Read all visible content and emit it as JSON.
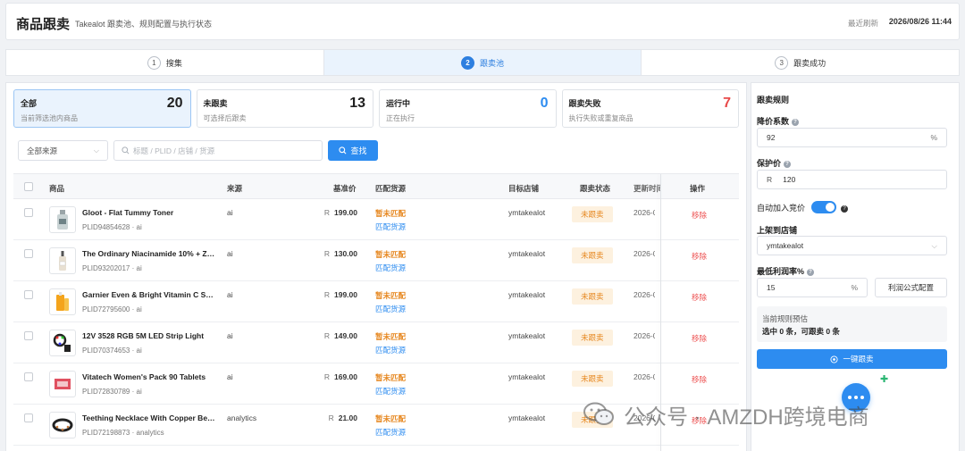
{
  "header": {
    "title": "商品跟卖",
    "subtitle": "Takealot 跟卖池、规则配置与执行状态",
    "refresh_label": "最近刷新",
    "refresh_time": "2026/08/26 11:44"
  },
  "steps": [
    {
      "num": "1",
      "label": "搜集"
    },
    {
      "num": "2",
      "label": "跟卖池"
    },
    {
      "num": "3",
      "label": "跟卖成功"
    }
  ],
  "stats": [
    {
      "label": "全部",
      "desc": "当前筛选池内商品",
      "value": "20",
      "color": "#1f1f1f"
    },
    {
      "label": "未跟卖",
      "desc": "可选择后跟卖",
      "value": "13",
      "color": "#1f1f1f"
    },
    {
      "label": "运行中",
      "desc": "正在执行",
      "value": "0",
      "color": "#2d8cf0"
    },
    {
      "label": "跟卖失败",
      "desc": "执行失败或重复商品",
      "value": "7",
      "color": "#e84a4a"
    }
  ],
  "filters": {
    "source_select": "全部来源",
    "search_placeholder": "标题 / PLID / 店铺 / 货源",
    "query_button": "查找"
  },
  "table": {
    "columns": {
      "product": "商品",
      "source": "来源",
      "base_price": "基准价",
      "match_source": "匹配货源",
      "target_store": "目标店铺",
      "follow_status": "跟卖状态",
      "updated": "更新时间",
      "action": "操作"
    },
    "rows": [
      {
        "name": "Gloot - Flat Tummy Toner",
        "plid": "PLID94854628 · ai",
        "source": "ai",
        "currency": "R",
        "price": "199.00",
        "match_status": "暂未匹配",
        "match_link": "匹配货源",
        "store": "ymtakealot",
        "status": "未跟卖",
        "updated": "2026-0",
        "action": "移除",
        "thumb": "bottle"
      },
      {
        "name": "The Ordinary Niacinamide 10% + Zinc 1%",
        "plid": "PLID93202017 · ai",
        "source": "ai",
        "currency": "R",
        "price": "130.00",
        "match_status": "暂未匹配",
        "match_link": "匹配货源",
        "store": "ymtakealot",
        "status": "未跟卖",
        "updated": "2026-0",
        "action": "移除",
        "thumb": "dropper"
      },
      {
        "name": "Garnier Even & Bright Vitamin C Serum",
        "plid": "PLID72795600 · ai",
        "source": "ai",
        "currency": "R",
        "price": "199.00",
        "match_status": "暂未匹配",
        "match_link": "匹配货源",
        "store": "ymtakealot",
        "status": "未跟卖",
        "updated": "2026-0",
        "action": "移除",
        "thumb": "serum"
      },
      {
        "name": "12V 3528 RGB 5M LED Strip Light",
        "plid": "PLID70374653 · ai",
        "source": "ai",
        "currency": "R",
        "price": "149.00",
        "match_status": "暂未匹配",
        "match_link": "匹配货源",
        "store": "ymtakealot",
        "status": "未跟卖",
        "updated": "2026-0",
        "action": "移除",
        "thumb": "led"
      },
      {
        "name": "Vitatech Women's Pack 90 Tablets",
        "plid": "PLID72830789 · ai",
        "source": "ai",
        "currency": "R",
        "price": "169.00",
        "match_status": "暂未匹配",
        "match_link": "匹配货源",
        "store": "ymtakealot",
        "status": "未跟卖",
        "updated": "2026-0",
        "action": "移除",
        "thumb": "pack"
      },
      {
        "name": "Teething Necklace With Copper Beads",
        "plid": "PLID72198873 · analytics",
        "source": "analytics",
        "currency": "R",
        "price": "21.00",
        "match_status": "暂未匹配",
        "match_link": "匹配货源",
        "store": "ymtakealot",
        "status": "未跟卖",
        "updated": "2026-0",
        "action": "移除",
        "thumb": "necklace"
      }
    ]
  },
  "rules": {
    "title": "跟卖规则",
    "discount_label": "降价系数",
    "discount_value": "92",
    "discount_suffix": "%",
    "protect_label": "保护价",
    "protect_prefix": "R",
    "protect_value": "120",
    "auto_bid_label": "自动加入竞价",
    "store_label": "上架到店铺",
    "store_value": "ymtakealot",
    "margin_label": "最低利润率%",
    "margin_value": "15",
    "margin_suffix": "%",
    "profit_button": "利润公式配置",
    "preview_title": "当前规则预估",
    "preview_text": "选中 0 条，可跟卖 0 条",
    "main_button": "一键跟卖"
  },
  "watermark": "公众号 · AMZDH跨境电商",
  "colors": {
    "accent": "#2d8cf0",
    "warning": "#e6861d",
    "danger": "#ec4b4b"
  }
}
